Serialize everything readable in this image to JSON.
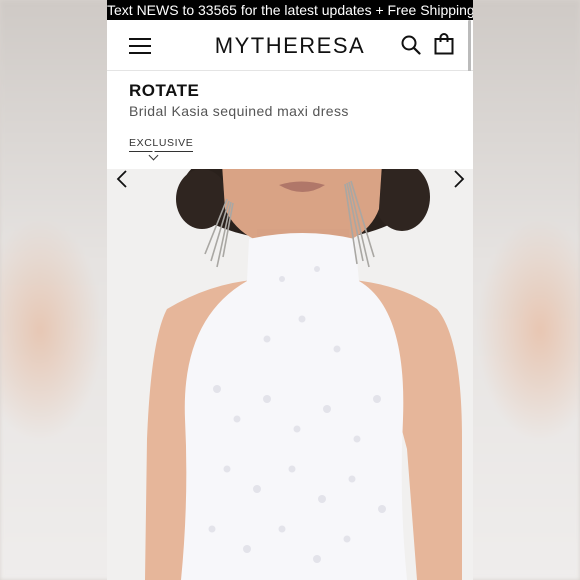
{
  "promo": {
    "text": "Text NEWS to 33565 for the latest updates + Free Shipping"
  },
  "header": {
    "logo": "MYTHERESA"
  },
  "icons": {
    "menu": "hamburger-menu-icon",
    "search": "search-icon",
    "bag": "shopping-bag-icon",
    "prev": "chevron-left-icon",
    "next": "chevron-right-icon"
  },
  "product": {
    "brand": "ROTATE",
    "name": "Bridal Kasia sequined maxi dress",
    "badge": "EXCLUSIVE"
  },
  "colors": {
    "promo_bg": "#000000",
    "dress": "#f7f7fa",
    "skin": "#e6b69a",
    "hair": "#2a211c"
  }
}
